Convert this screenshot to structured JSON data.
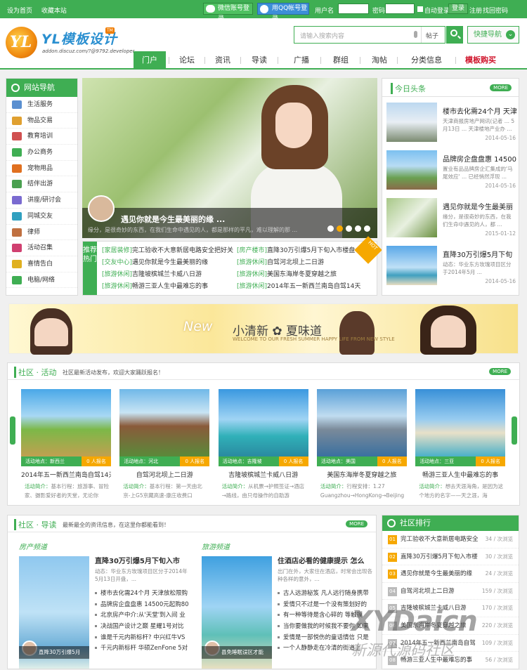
{
  "topbar": {
    "set_home": "设为首页",
    "bookmark": "收藏本站",
    "wechat_login": "微信账号登录",
    "qq_login": "用QQ帐号登录",
    "username_label": "用户名",
    "password_label": "密码",
    "auto_login": "自动登录",
    "login": "登录",
    "register": "注册",
    "forgot": "找回密码"
  },
  "header": {
    "logo_text": "YL模板设计",
    "logo_mark": "YL",
    "logo_badge": "TM",
    "logo_sub": "addon.discuz.com/?@9792.developer",
    "search_placeholder": "请输入搜索内容",
    "search_scope": "帖子",
    "quick_nav": "快捷导航"
  },
  "nav": {
    "items": [
      "门户",
      "论坛",
      "资讯",
      "导读",
      "广播",
      "群组",
      "淘帖",
      "分类信息",
      "模板购买"
    ]
  },
  "side_nav": {
    "title": "网站导航",
    "items": [
      "生活服务",
      "物品交易",
      "教育培训",
      "办公商务",
      "宠物用品",
      "结伴出游",
      "讲座/研讨会",
      "同城交友",
      "律师",
      "活动召集",
      "喜情告白",
      "电脑/网络"
    ],
    "icon_colors": [
      "#5a8fd0",
      "#e0a030",
      "#d05050",
      "#3fae53",
      "#e07020",
      "#4aa050",
      "#7a6ad0",
      "#30a0c0",
      "#c07040",
      "#d04070",
      "#e0b020",
      "#3fae53"
    ]
  },
  "slider": {
    "title": "遇见你就是今生最美丽的缘 ...",
    "desc": "缘分，是很奇妙的东西，在我们生命中遇见的人，都是那样的平凡，难以理解的那 ...",
    "dots": 5,
    "active_dot": 1
  },
  "recommend": {
    "tag": "推荐热门",
    "hot": "HOT",
    "left": [
      {
        "cat": "[家居装修]",
        "title": "完工验收不大意新居电路安全把好关"
      },
      {
        "cat": "[交友中心]",
        "title": "遇见你就是今生最美丽的缘"
      },
      {
        "cat": "[旅游休闲]",
        "title": "吉隆坡槟城兰卡威八日游"
      },
      {
        "cat": "[旅游休闲]",
        "title": "畅游三亚人生中最难忘的事"
      }
    ],
    "right": [
      {
        "cat": "[房产楼市]",
        "title": "直降30万引爆5月下旬入市楼盘 160"
      },
      {
        "cat": "[旅游休闲]",
        "title": "自驾河北坝上二日游"
      },
      {
        "cat": "[旅游休闲]",
        "title": "美国东海岸冬夏穿越之旅"
      },
      {
        "cat": "[旅游休闲]",
        "title": "2014年五一新西兰南岛自驾14天"
      }
    ]
  },
  "today": {
    "title": "今日头条",
    "more": "MORE",
    "items": [
      {
        "title": "楼市去化需24个月 天津",
        "desc": "天津商报房地产网讯(记者 ... 5月13日 ... 天津楼地产业办 ...",
        "date": "2014-05-16"
      },
      {
        "title": "品牌房企盘盘惠 14500",
        "desc": "置业有品品牌房企汇集成的'马尾效应' ... 已经悄然浮现 ...",
        "date": "2014-05-16"
      },
      {
        "title": "遇见你就是今生最美丽",
        "desc": "缘分，是很奇妙的东西，在我们生命中遇见的人，都 ...",
        "date": "2015-01-12"
      },
      {
        "title": "直降30万引爆5月下旬",
        "desc": "动态：华业东方玫瑰项目区分于2014年5月 ...",
        "date": "2014-05-16"
      }
    ]
  },
  "banner": {
    "script_text": "New",
    "title": "小清新 ✿ 夏味道",
    "sub": "WELCOME TO OUR FRESH SUMMER HAPPY LIFE FROM NEW STYLE"
  },
  "activity": {
    "title": "社区 · 活动",
    "subtitle": "社区最新活动发布，欢迎大家踊跃报名！",
    "more": "MORE",
    "place_label": "活动地点：",
    "signup_suffix": "0 人报名",
    "intro_label": "活动简介：",
    "cards": [
      {
        "place": "新西兰",
        "title": "2014年五一新西兰南岛自驾14天",
        "desc": "基本行程：旅游事、冒险家、摄影爱好者的天堂，无论你"
      },
      {
        "place": "河北",
        "title": "自驾河北坝上二日游",
        "desc": "基本行程：第一天由北京-上G5京藏高速-康庄收费口"
      },
      {
        "place": "吉隆坡",
        "title": "吉隆坡槟城兰卡威八日游",
        "desc": "从机票→护照签证→酒店→路线，由只母操作的自助游"
      },
      {
        "place": "美国",
        "title": "美国东海岸冬夏穿越之旅",
        "desc": "行程安排：1.27 Guangzhou→HongKong→Beijing"
      },
      {
        "place": "三亚",
        "title": "畅游三亚人生中最难忘的事",
        "desc": "想去天涯海角，是因为这个地方的名字——天之涯，海"
      }
    ]
  },
  "guide": {
    "title": "社区 · 导读",
    "subtitle": "最新最全的资讯信息，在这里你都能看到！",
    "more": "MORE",
    "house": {
      "heading": "房产频道",
      "pic_caption": "直降30万引爆5月",
      "title": "直降30万引爆5月下旬入市",
      "desc": "动态：华业东方玫瑰项目区分于2014年5月13日开盘，...",
      "items": [
        "楼市去化需24个月 天津放松限购",
        "品牌房企盘盘惠 14500元起购80",
        "北京房产中介:从'天堂'到入间 业",
        "决战国产设计之巅 星耀1号对比",
        "谁是千元内新标杆? 中兴红牛VS",
        "千元内新标杆 华硕ZenFone 5对"
      ]
    },
    "travel": {
      "heading": "旅游频道",
      "pic_caption": "县免睡眠误区才能",
      "title": "住酒店必看的健康提示 怎么",
      "desc": "出门在外，大家住在酒店，时常会出现各种各样的意外，...",
      "items": [
        "古人远游秘笈 凡人远行随身携带",
        "爱情只不过是一个没有策划好的",
        "有一种等待是含心碎的 等触摸",
        "当你要做我的时候我不要你 如果",
        "爱情是一部悦伤的童话情信 只是",
        "一个人静静走在冷清的街道上"
      ]
    }
  },
  "ranking": {
    "title": "社区排行",
    "views_suffix": "次浏览",
    "items": [
      {
        "n": "01",
        "title": "完工验收不大意新居电路安全",
        "views": "34"
      },
      {
        "n": "02",
        "title": "直降30万引爆5月下旬入市楼",
        "views": "30"
      },
      {
        "n": "03",
        "title": "遇见你就是今生最美丽的缘",
        "views": "24"
      },
      {
        "n": "04",
        "title": "自驾河北坝上二日游",
        "views": "159"
      },
      {
        "n": "05",
        "title": "吉隆坡槟城兰卡威八日游",
        "views": "170"
      },
      {
        "n": "06",
        "title": "美国东海岸冬夏穿越之旅",
        "views": "220"
      },
      {
        "n": "07",
        "title": "2014年五一新西兰南岛自驾",
        "views": "109"
      },
      {
        "n": "08",
        "title": "畅游三亚人生中最难忘的事",
        "views": "56"
      }
    ]
  },
  "watermark": {
    "main": "XYDaicn",
    "sub": "新源代源码社区"
  }
}
